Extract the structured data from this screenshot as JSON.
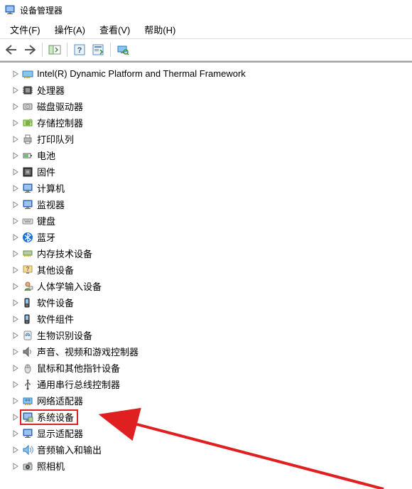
{
  "window": {
    "title": "设备管理器"
  },
  "menu": {
    "file": "文件(F)",
    "action": "操作(A)",
    "view": "查看(V)",
    "help": "帮助(H)"
  },
  "tree": {
    "items": [
      {
        "label": "Intel(R) Dynamic Platform and Thermal Framework",
        "icon": "card"
      },
      {
        "label": "处理器",
        "icon": "cpu"
      },
      {
        "label": "磁盘驱动器",
        "icon": "disk"
      },
      {
        "label": "存储控制器",
        "icon": "storage"
      },
      {
        "label": "打印队列",
        "icon": "printer"
      },
      {
        "label": "电池",
        "icon": "battery"
      },
      {
        "label": "固件",
        "icon": "firmware"
      },
      {
        "label": "计算机",
        "icon": "monitor"
      },
      {
        "label": "监视器",
        "icon": "monitor"
      },
      {
        "label": "键盘",
        "icon": "keyboard"
      },
      {
        "label": "蓝牙",
        "icon": "bluetooth"
      },
      {
        "label": "内存技术设备",
        "icon": "memory"
      },
      {
        "label": "其他设备",
        "icon": "other"
      },
      {
        "label": "人体学输入设备",
        "icon": "hid"
      },
      {
        "label": "软件设备",
        "icon": "software"
      },
      {
        "label": "软件组件",
        "icon": "software"
      },
      {
        "label": "生物识别设备",
        "icon": "biometric"
      },
      {
        "label": "声音、视频和游戏控制器",
        "icon": "sound"
      },
      {
        "label": "鼠标和其他指针设备",
        "icon": "mouse"
      },
      {
        "label": "通用串行总线控制器",
        "icon": "usb"
      },
      {
        "label": "网络适配器",
        "icon": "network"
      },
      {
        "label": "系统设备",
        "icon": "system",
        "highlight": true
      },
      {
        "label": "显示适配器",
        "icon": "display"
      },
      {
        "label": "音频输入和输出",
        "icon": "audio"
      },
      {
        "label": "照相机",
        "icon": "camera"
      }
    ]
  }
}
